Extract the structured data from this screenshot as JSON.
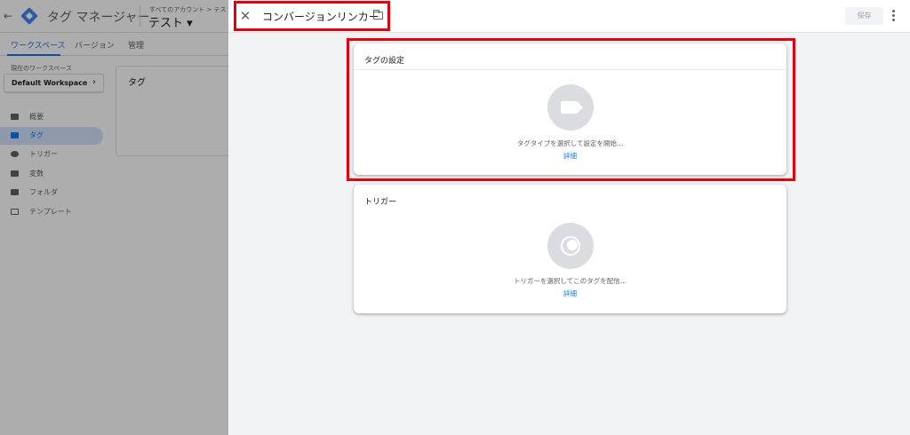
{
  "background": {
    "product_name": "タグ マネージャー",
    "breadcrumb": "すべてのアカウント > テスト",
    "container_name": "テスト ▾",
    "tabs": [
      {
        "label": "ワークスペース"
      },
      {
        "label": "バージョン"
      },
      {
        "label": "管理"
      }
    ],
    "workspace_label": "現在のワークスペース",
    "workspace_name": "Default Workspace",
    "nav_items": [
      {
        "label": "概要",
        "icon": "overview-icon"
      },
      {
        "label": "タグ",
        "icon": "tag-icon",
        "active": true
      },
      {
        "label": "トリガー",
        "icon": "trigger-icon"
      },
      {
        "label": "変数",
        "icon": "variables-icon"
      },
      {
        "label": "フォルダ",
        "icon": "folder-icon"
      },
      {
        "label": "テンプレート",
        "icon": "template-icon"
      }
    ],
    "content_card_title": "タグ"
  },
  "sheet": {
    "tag_name": "コンバージョンリンカー",
    "save_label": "保存",
    "tag_config": {
      "title": "タグの設定",
      "hint": "タグタイプを選択して設定を開始...",
      "link": "詳細"
    },
    "trigger": {
      "title": "トリガー",
      "hint": "トリガーを選択してこのタグを配信...",
      "link": "詳細"
    }
  },
  "colors": {
    "accent": "#1a73e8",
    "highlight": "#e3000f",
    "placeholder": "#dadce0"
  }
}
